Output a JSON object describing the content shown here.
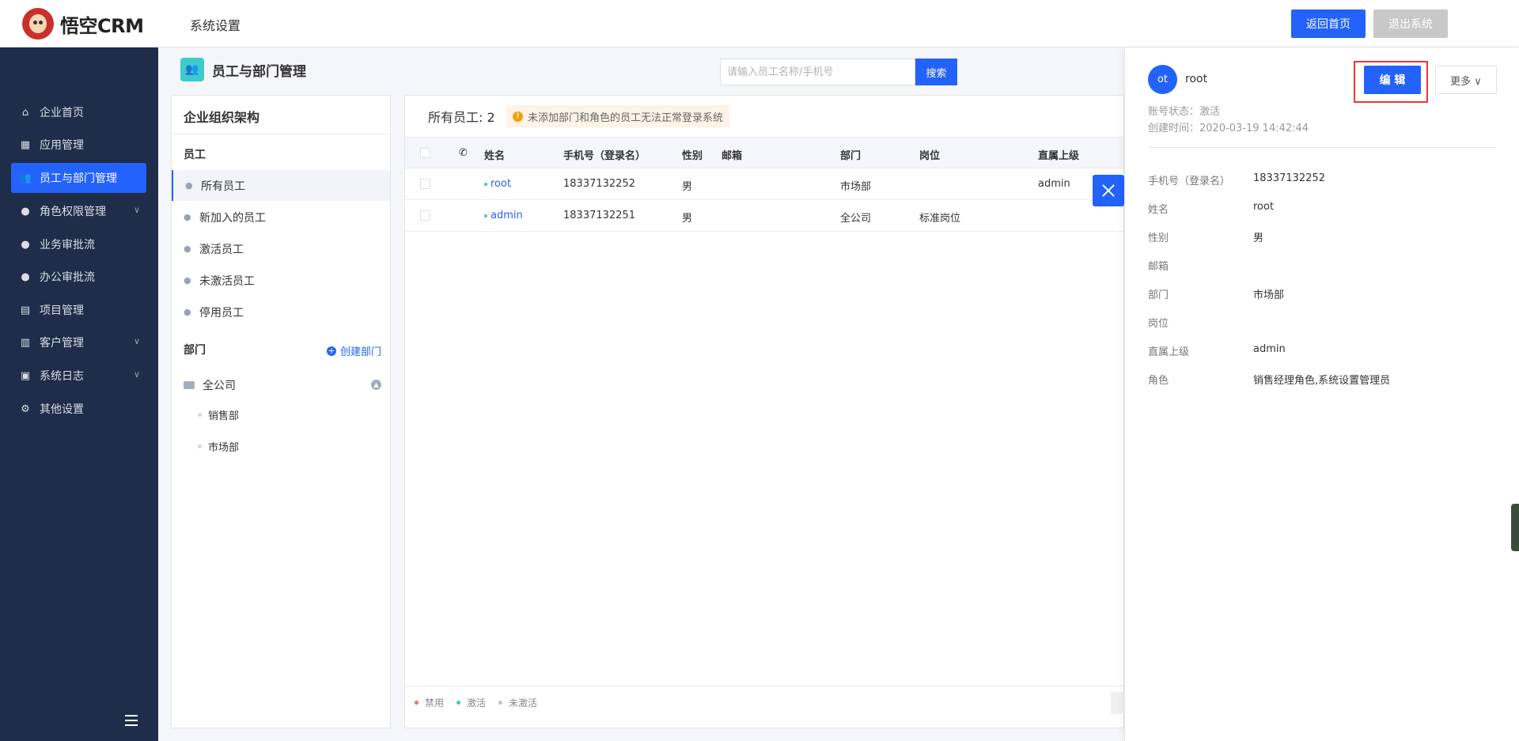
{
  "header": {
    "logo_text": "悟空CRM",
    "section_title": "系统设置",
    "home_button": "返回首页",
    "exit_button": "退出系统"
  },
  "sidebar": {
    "items": [
      {
        "label": "企业首页",
        "icon": "home-icon"
      },
      {
        "label": "应用管理",
        "icon": "grid-icon"
      },
      {
        "label": "员工与部门管理",
        "icon": "users-icon",
        "active": true
      },
      {
        "label": "角色权限管理",
        "icon": "user-icon",
        "has_children": true
      },
      {
        "label": "业务审批流",
        "icon": "user-icon"
      },
      {
        "label": "办公审批流",
        "icon": "user-icon"
      },
      {
        "label": "项目管理",
        "icon": "book-icon"
      },
      {
        "label": "客户管理",
        "icon": "chart-icon",
        "has_children": true
      },
      {
        "label": "系统日志",
        "icon": "clipboard-icon",
        "has_children": true
      },
      {
        "label": "其他设置",
        "icon": "gear-icon"
      }
    ]
  },
  "page": {
    "title": "员工与部门管理",
    "search_placeholder": "请输入员工名称/手机号",
    "search_button": "搜索"
  },
  "org": {
    "title": "企业组织架构",
    "employees_label": "员工",
    "employee_filters": [
      "所有员工",
      "新加入的员工",
      "激活员工",
      "未激活员工",
      "停用员工"
    ],
    "departments_label": "部门",
    "create_dept": "创建部门",
    "root_dept": "全公司",
    "sub_depts": [
      "销售部",
      "市场部"
    ]
  },
  "table": {
    "count_label": "所有员工: 2",
    "warning": "未添加部门和角色的员工无法正常登录系统",
    "columns": [
      "姓名",
      "手机号（登录名）",
      "性别",
      "邮箱",
      "部门",
      "岗位",
      "直属上级"
    ],
    "rows": [
      {
        "name": "root",
        "phone": "18337132252",
        "gender": "男",
        "email": "",
        "dept": "市场部",
        "post": "",
        "leader": "admin"
      },
      {
        "name": "admin",
        "phone": "18337132251",
        "gender": "男",
        "email": "",
        "dept": "全公司",
        "post": "标准岗位",
        "leader": ""
      }
    ],
    "legend": [
      "禁用",
      "激活",
      "未激活"
    ],
    "legend_colors": [
      "#f56c6c",
      "#3dcbcb",
      "#c0c4cc"
    ]
  },
  "detail": {
    "avatar": "ot",
    "name": "root",
    "edit_button": "编 辑",
    "more_button": "更多 ∨",
    "status": "账号状态：激活",
    "created": "创建时间：2020-03-19 14:42:44",
    "fields": [
      {
        "label": "手机号（登录名）",
        "value": "18337132252"
      },
      {
        "label": "姓名",
        "value": "root"
      },
      {
        "label": "性别",
        "value": "男"
      },
      {
        "label": "邮箱",
        "value": ""
      },
      {
        "label": "部门",
        "value": "市场部"
      },
      {
        "label": "岗位",
        "value": ""
      },
      {
        "label": "直属上级",
        "value": "admin"
      },
      {
        "label": "角色",
        "value": "销售经理角色,系统设置管理员"
      }
    ]
  },
  "colors": {
    "accent": "#2362fb",
    "sidebar": "#1f2d4a",
    "highlight": "#e53935"
  }
}
